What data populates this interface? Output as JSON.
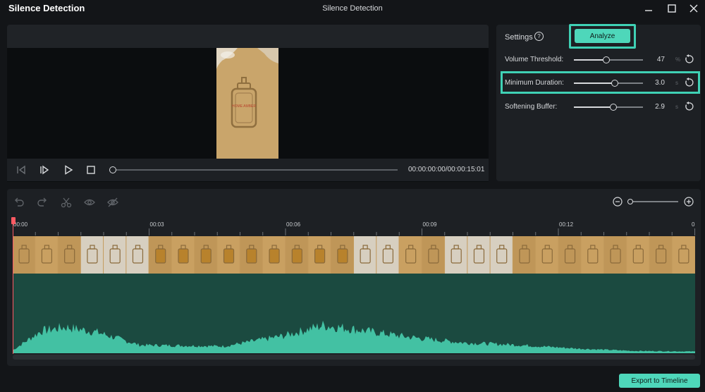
{
  "window": {
    "app_title": "Silence Detection",
    "title": "Silence Detection",
    "controls": [
      "minimize-icon",
      "maximize-icon",
      "close-icon"
    ]
  },
  "preview": {
    "timecode": "00:00:00:00/00:00:15:01",
    "progress": 0.0,
    "controls": [
      "prev-frame-icon",
      "play-step-icon",
      "play-icon",
      "stop-icon"
    ],
    "frame_text": "HOME AMBER"
  },
  "settings": {
    "label": "Settings",
    "analyze_label": "Analyze",
    "rows": [
      {
        "label": "Volume Threshold:",
        "value": "47",
        "unit": "%",
        "level": 0.47
      },
      {
        "label": "Minimum Duration:",
        "value": "3.0",
        "unit": "s",
        "level": 0.59
      },
      {
        "label": "Softening Buffer:",
        "value": "2.9",
        "unit": "s",
        "level": 0.57
      }
    ]
  },
  "timeline": {
    "tools": [
      "undo-icon",
      "redo-icon",
      "scissors-icon",
      "eye-icon",
      "eye-off-icon"
    ],
    "zoom_level": 0.0,
    "ruler": [
      {
        "label": "00:00",
        "t": 0
      },
      {
        "label": "00:03",
        "t": 3
      },
      {
        "label": "00:06",
        "t": 6
      },
      {
        "label": "00:09",
        "t": 9
      },
      {
        "label": "00:12",
        "t": 12
      },
      {
        "label": "0",
        "t": 15
      }
    ],
    "duration_seconds": 15.03
  },
  "export_label": "Export to Timeline",
  "colors": {
    "accent": "#4ed7ba",
    "playhead": "#ff5a63",
    "audio_bg": "#1b4a40",
    "waveform": "#43c1a3",
    "thumb": "#c39a5c"
  }
}
